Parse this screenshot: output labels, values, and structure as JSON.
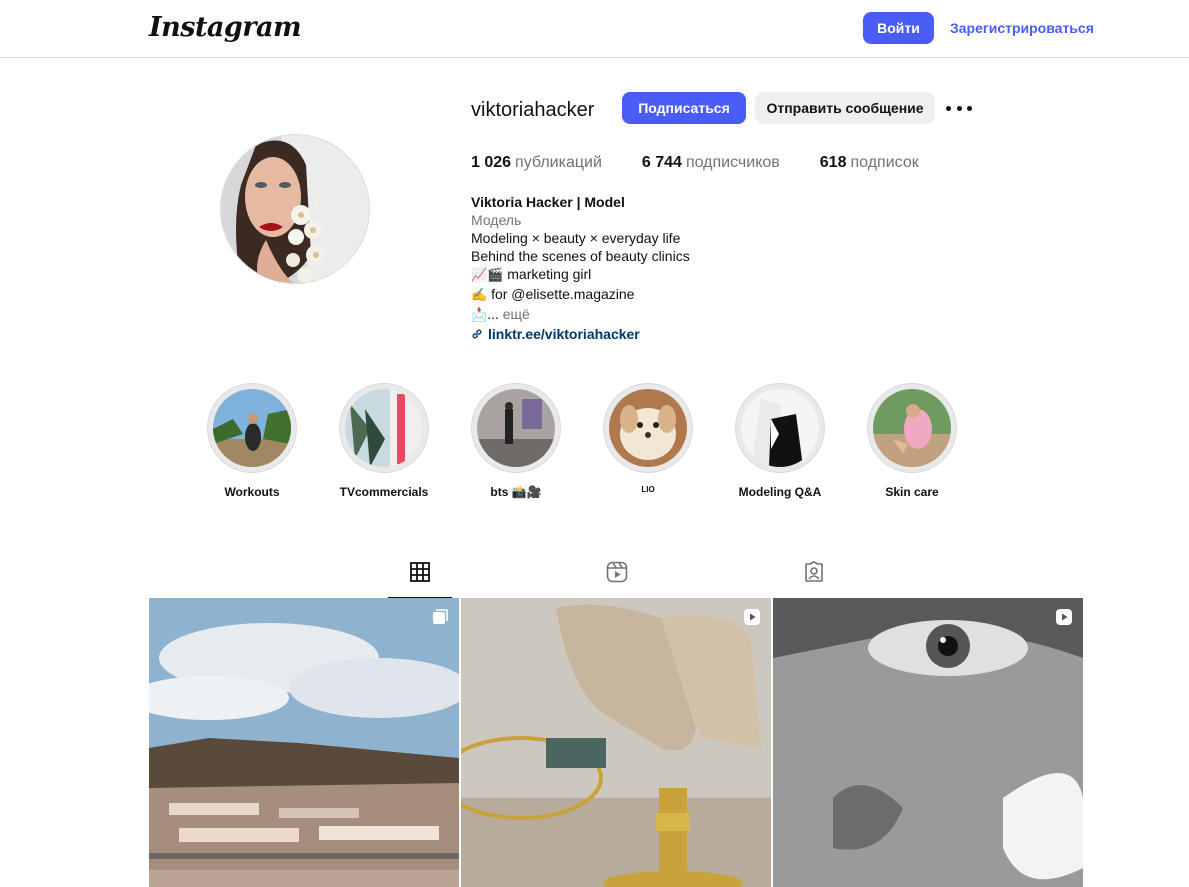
{
  "header": {
    "logo": "Instagram",
    "login_label": "Войти",
    "register_label": "Зарегистрироваться"
  },
  "profile": {
    "username": "viktoriahacker",
    "follow_label": "Подписаться",
    "message_label": "Отправить сообщение",
    "stats": {
      "posts_value": "1 026",
      "posts_label": "публикаций",
      "followers_value": "6 744",
      "followers_label": "подписчиков",
      "following_value": "618",
      "following_label": "подписок"
    },
    "bio": {
      "full_name": "Viktoria Hacker | Model",
      "category": "Модель",
      "line1": "Modeling × beauty × everyday life",
      "line2": "Behind the scenes of beauty clinics",
      "line3_emoji": "📈🎬",
      "line3_text": "marketing girl",
      "line4_emoji": "✍️",
      "line4_text": "for @elisette.magazine",
      "line5_emoji": "📩",
      "line5_text": "...",
      "more_label": "ещё",
      "link": "linktr.ee/viktoriahacker"
    }
  },
  "highlights": [
    {
      "label": "Workouts"
    },
    {
      "label": "TVcommercials"
    },
    {
      "label": "bts 📸🎥"
    },
    {
      "label": "LIO"
    },
    {
      "label": "Modeling Q&A"
    },
    {
      "label": "Skin care"
    }
  ],
  "tabs": [
    {
      "icon": "grid-icon",
      "active": true
    },
    {
      "icon": "reels-icon",
      "active": false
    },
    {
      "icon": "tagged-icon",
      "active": false
    }
  ],
  "posts": [
    {
      "badge": "carousel-icon"
    },
    {
      "badge": "reel-icon"
    },
    {
      "badge": "reel-icon"
    }
  ],
  "colors": {
    "accent": "#4a5df9",
    "link": "#00376b",
    "secondary_text": "#737373",
    "button_gray": "#efefef"
  }
}
